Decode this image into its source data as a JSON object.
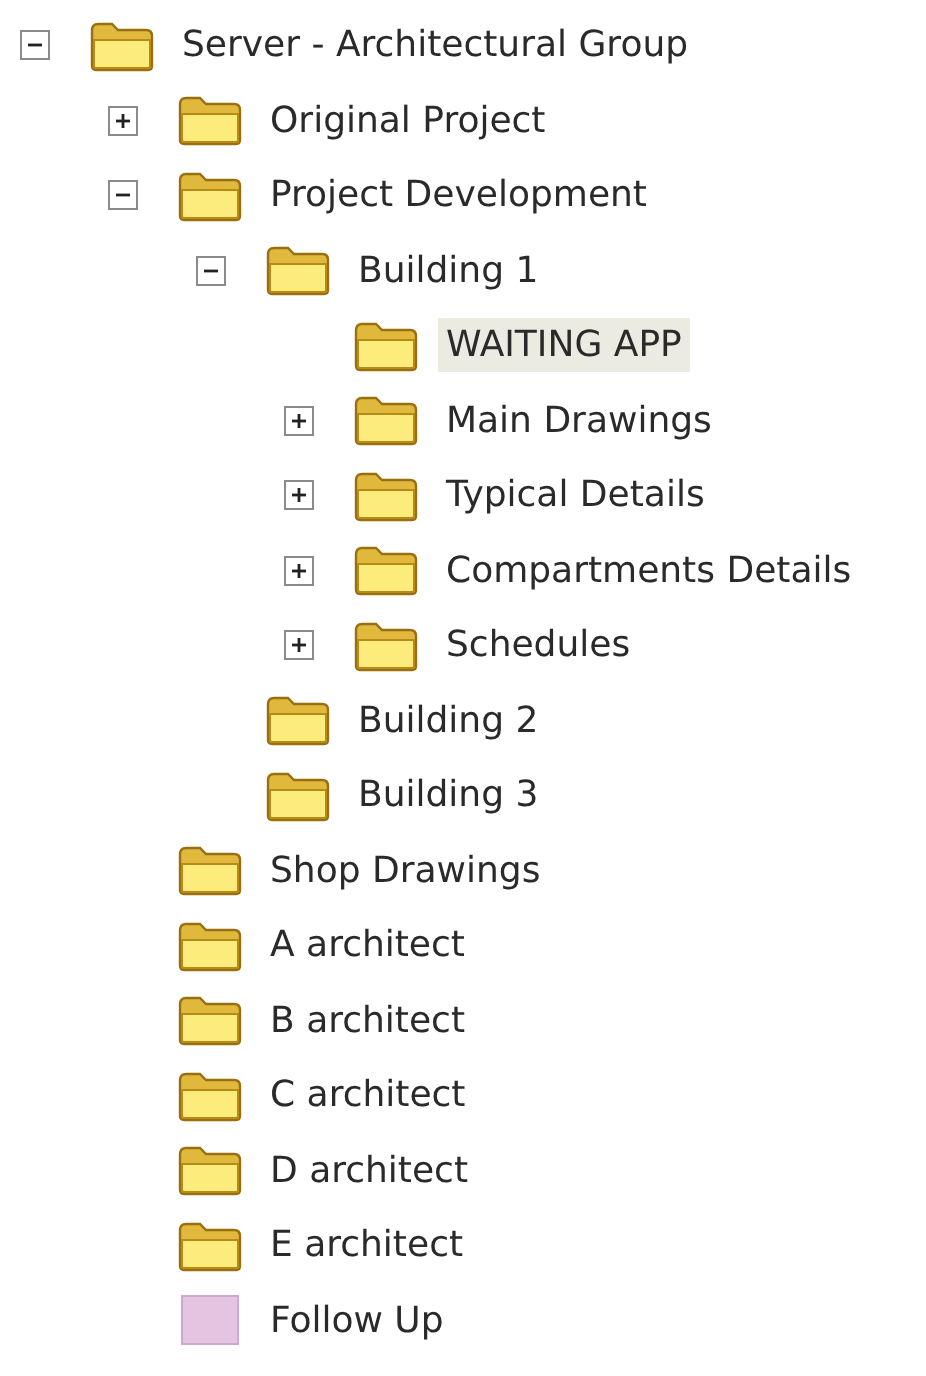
{
  "tree": [
    {
      "label": "Server - Architectural Group",
      "kind": "folder",
      "expanded": true,
      "selected": false,
      "children": [
        {
          "label": "Original Project",
          "kind": "folder",
          "expanded": false,
          "selected": false
        },
        {
          "label": "Project Development",
          "kind": "folder",
          "expanded": true,
          "selected": false,
          "children": [
            {
              "label": "Building 1",
              "kind": "folder",
              "expanded": true,
              "selected": false,
              "children": [
                {
                  "label": "WAITING APP",
                  "kind": "folder",
                  "selected": true
                },
                {
                  "label": "Main Drawings",
                  "kind": "folder",
                  "expanded": false,
                  "selected": false
                },
                {
                  "label": "Typical Details",
                  "kind": "folder",
                  "expanded": false,
                  "selected": false
                },
                {
                  "label": "Compartments Details",
                  "kind": "folder",
                  "expanded": false,
                  "selected": false
                },
                {
                  "label": "Schedules",
                  "kind": "folder",
                  "expanded": false,
                  "selected": false
                }
              ]
            },
            {
              "label": "Building 2",
              "kind": "folder",
              "selected": false
            },
            {
              "label": "Building 3",
              "kind": "folder",
              "selected": false
            }
          ]
        },
        {
          "label": "Shop Drawings",
          "kind": "folder",
          "selected": false
        },
        {
          "label": "A architect",
          "kind": "folder",
          "selected": false
        },
        {
          "label": "B architect",
          "kind": "folder",
          "selected": false
        },
        {
          "label": "C architect",
          "kind": "folder",
          "selected": false
        },
        {
          "label": "D architect",
          "kind": "folder",
          "selected": false
        },
        {
          "label": "E architect",
          "kind": "folder",
          "selected": false
        },
        {
          "label": "Follow Up",
          "kind": "note",
          "selected": false
        }
      ]
    }
  ]
}
